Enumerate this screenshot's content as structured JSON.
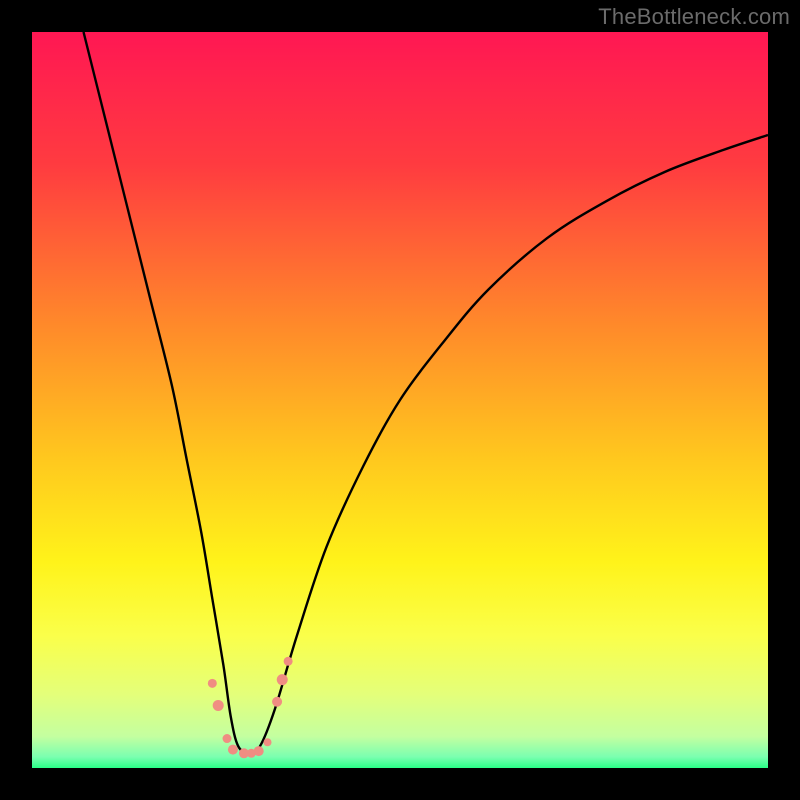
{
  "watermark": "TheBottleneck.com",
  "chart_data": {
    "type": "line",
    "title": "",
    "xlabel": "",
    "ylabel": "",
    "xlim": [
      0,
      100
    ],
    "ylim": [
      0,
      100
    ],
    "grid": false,
    "legend": false,
    "gradient_stops": [
      {
        "offset": 0,
        "color": "#ff1753"
      },
      {
        "offset": 0.18,
        "color": "#ff3b40"
      },
      {
        "offset": 0.4,
        "color": "#ff8a2a"
      },
      {
        "offset": 0.58,
        "color": "#ffc81e"
      },
      {
        "offset": 0.72,
        "color": "#fff31a"
      },
      {
        "offset": 0.82,
        "color": "#faff4a"
      },
      {
        "offset": 0.9,
        "color": "#e4ff7a"
      },
      {
        "offset": 0.957,
        "color": "#c4ffa0"
      },
      {
        "offset": 0.985,
        "color": "#7affb0"
      },
      {
        "offset": 1.0,
        "color": "#29ff87"
      }
    ],
    "series": [
      {
        "name": "bottleneck-curve",
        "x": [
          7,
          10,
          13,
          16,
          19,
          21,
          23,
          24.5,
          26,
          27,
          28,
          29.5,
          31,
          33,
          36,
          40,
          45,
          50,
          56,
          62,
          70,
          78,
          86,
          94,
          100
        ],
        "y": [
          100,
          88,
          76,
          64,
          52,
          42,
          32,
          23,
          14,
          7,
          3,
          2,
          3,
          8,
          18,
          30,
          41,
          50,
          58,
          65,
          72,
          77,
          81,
          84,
          86
        ]
      }
    ],
    "markers": [
      {
        "x": 24.5,
        "y": 11.5,
        "r": 4.5
      },
      {
        "x": 25.3,
        "y": 8.5,
        "r": 5.5
      },
      {
        "x": 26.5,
        "y": 4.0,
        "r": 4.5
      },
      {
        "x": 27.3,
        "y": 2.5,
        "r": 5.0
      },
      {
        "x": 28.8,
        "y": 2.0,
        "r": 5.0
      },
      {
        "x": 29.8,
        "y": 2.0,
        "r": 4.5
      },
      {
        "x": 30.8,
        "y": 2.3,
        "r": 5.0
      },
      {
        "x": 32.0,
        "y": 3.5,
        "r": 4.0
      },
      {
        "x": 33.3,
        "y": 9.0,
        "r": 5.0
      },
      {
        "x": 34.0,
        "y": 12.0,
        "r": 5.5
      },
      {
        "x": 34.8,
        "y": 14.5,
        "r": 4.5
      }
    ],
    "marker_color": "#f08d82",
    "curve_color": "#000000"
  }
}
